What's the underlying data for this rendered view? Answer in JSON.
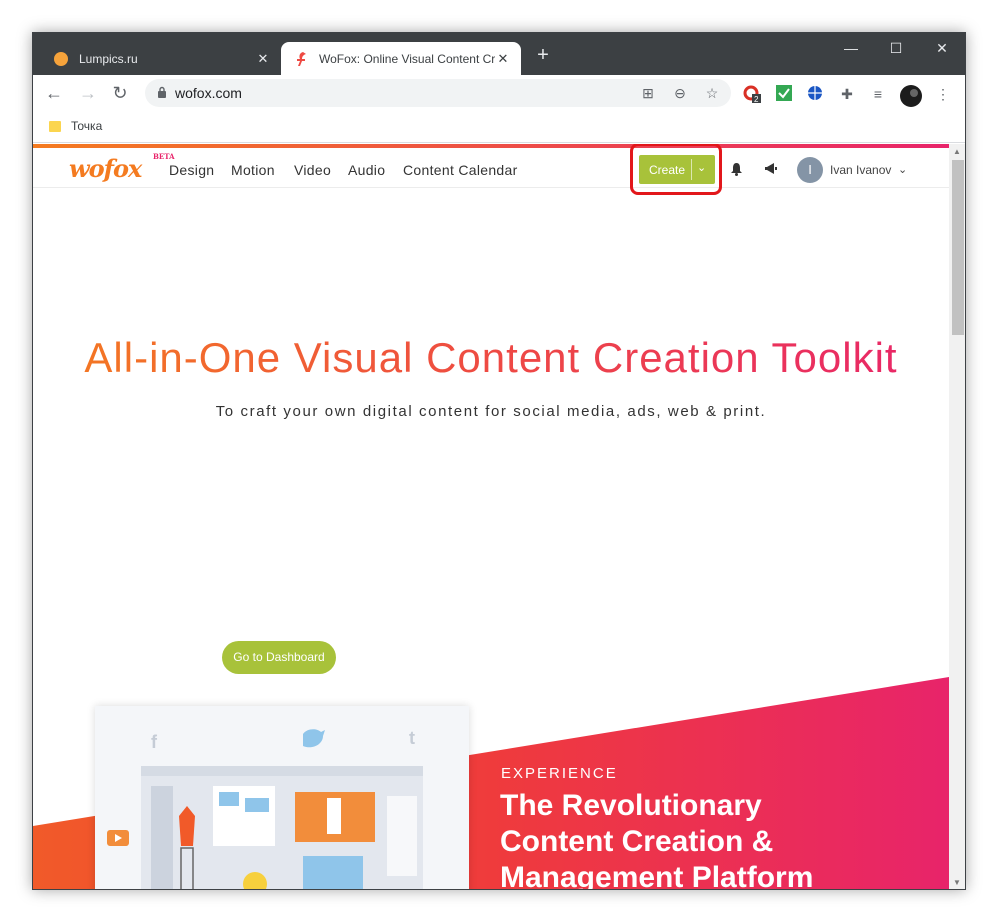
{
  "browser": {
    "tabs": [
      {
        "title": "Lumpics.ru",
        "close": "✕"
      },
      {
        "title": "WoFox: Online Visual Content Cr",
        "close": "✕"
      }
    ],
    "new_tab": "+",
    "window_controls": {
      "minimize": "—",
      "maximize": "☐",
      "close": "✕"
    },
    "url": "wofox.com",
    "bookmark": "Точка",
    "extension_badge": "2",
    "icons": [
      "back-icon",
      "forward-icon",
      "reload-icon",
      "lock-icon",
      "translate-icon",
      "zoom-icon",
      "star-icon",
      "puzzle-icon",
      "media-icon",
      "menu-icon"
    ]
  },
  "site": {
    "logo": "wofox",
    "logo_badge": "BETA",
    "menu": [
      "Design",
      "Motion",
      "Video",
      "Audio",
      "Content Calendar"
    ],
    "create_label": "Create",
    "user_initial": "I",
    "user_name": "Ivan Ivanov",
    "hero_title": "All-in-One Visual Content Creation Toolkit",
    "hero_subtitle": "To craft your own digital content for social media, ads, web & print.",
    "dashboard_button": "Go to Dashboard",
    "experience_label": "EXPERIENCE",
    "headline_lines": [
      "The Revolutionary",
      "Content Creation &",
      "Management Platform"
    ],
    "accent_colors": {
      "orange": "#f47b20",
      "pink": "#e8246a",
      "green": "#a8c23a",
      "highlight": "#e2171b"
    }
  }
}
